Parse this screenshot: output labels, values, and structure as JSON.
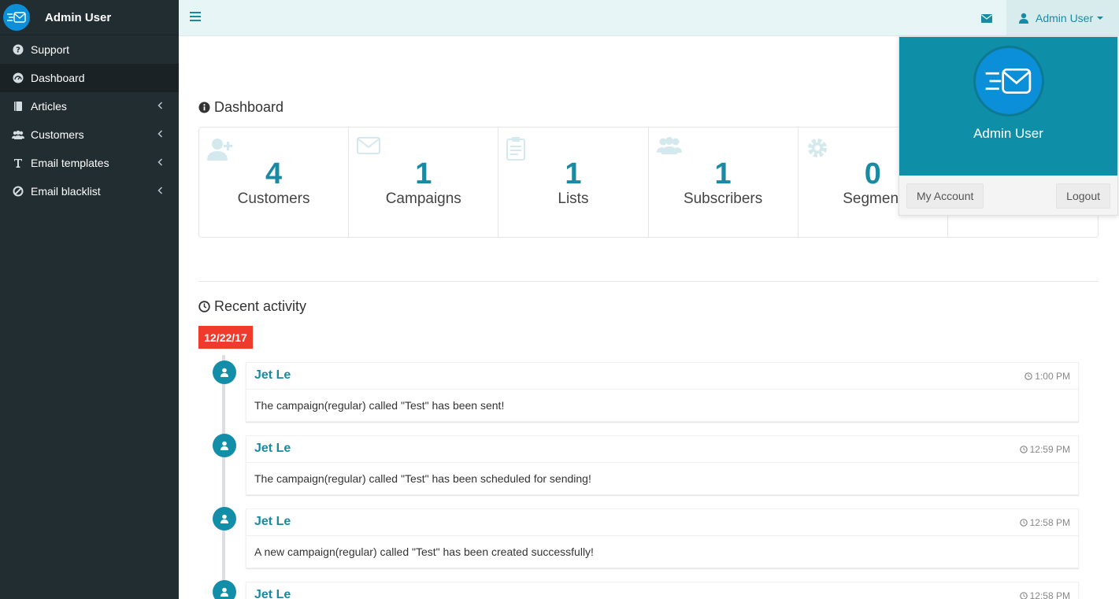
{
  "brand": {
    "name": "Admin User",
    "logo_icon": "mail-logo-icon"
  },
  "sidebar": {
    "items": [
      {
        "label": "Support",
        "icon": "question-circle-icon",
        "active": false,
        "has_children": false
      },
      {
        "label": "Dashboard",
        "icon": "dashboard-gauge-icon",
        "active": true,
        "has_children": false
      },
      {
        "label": "Articles",
        "icon": "book-icon",
        "active": false,
        "has_children": true
      },
      {
        "label": "Customers",
        "icon": "users-icon",
        "active": false,
        "has_children": true
      },
      {
        "label": "Email templates",
        "icon": "text-t-icon",
        "active": false,
        "has_children": true
      },
      {
        "label": "Email blacklist",
        "icon": "ban-icon",
        "active": false,
        "has_children": true
      }
    ]
  },
  "header": {
    "menu_icon": "hamburger-icon",
    "mail_icon": "envelope-icon",
    "user_label": "Admin User"
  },
  "dashboard": {
    "title": "Dashboard",
    "stats": [
      {
        "value": "4",
        "label": "Customers",
        "icon": "user-plus-icon"
      },
      {
        "value": "1",
        "label": "Campaigns",
        "icon": "envelope-outline-icon"
      },
      {
        "value": "1",
        "label": "Lists",
        "icon": "clipboard-icon"
      },
      {
        "value": "1",
        "label": "Subscribers",
        "icon": "users-icon"
      },
      {
        "value": "0",
        "label": "Segment",
        "icon": "gear-icon"
      },
      {
        "value": "",
        "label": "",
        "icon": ""
      }
    ]
  },
  "activity": {
    "title": "Recent activity",
    "date": "12/22/17",
    "items": [
      {
        "name": "Jet Le",
        "time": "1:00 PM",
        "message": "The campaign(regular) called \"Test\" has been sent!"
      },
      {
        "name": "Jet Le",
        "time": "12:59 PM",
        "message": "The campaign(regular) called \"Test\" has been scheduled for sending!"
      },
      {
        "name": "Jet Le",
        "time": "12:58 PM",
        "message": "A new campaign(regular) called \"Test\" has been created successfully!"
      },
      {
        "name": "Jet Le",
        "time": "12:58 PM",
        "message": ""
      }
    ]
  },
  "user_dropdown": {
    "name": "Admin User",
    "my_account_label": "My Account",
    "logout_label": "Logout"
  },
  "colors": {
    "sidebar_bg": "#222d32",
    "accent": "#1a8aa3",
    "dropdown_header": "#0f8ea8",
    "date_badge": "#ef3a2c"
  }
}
